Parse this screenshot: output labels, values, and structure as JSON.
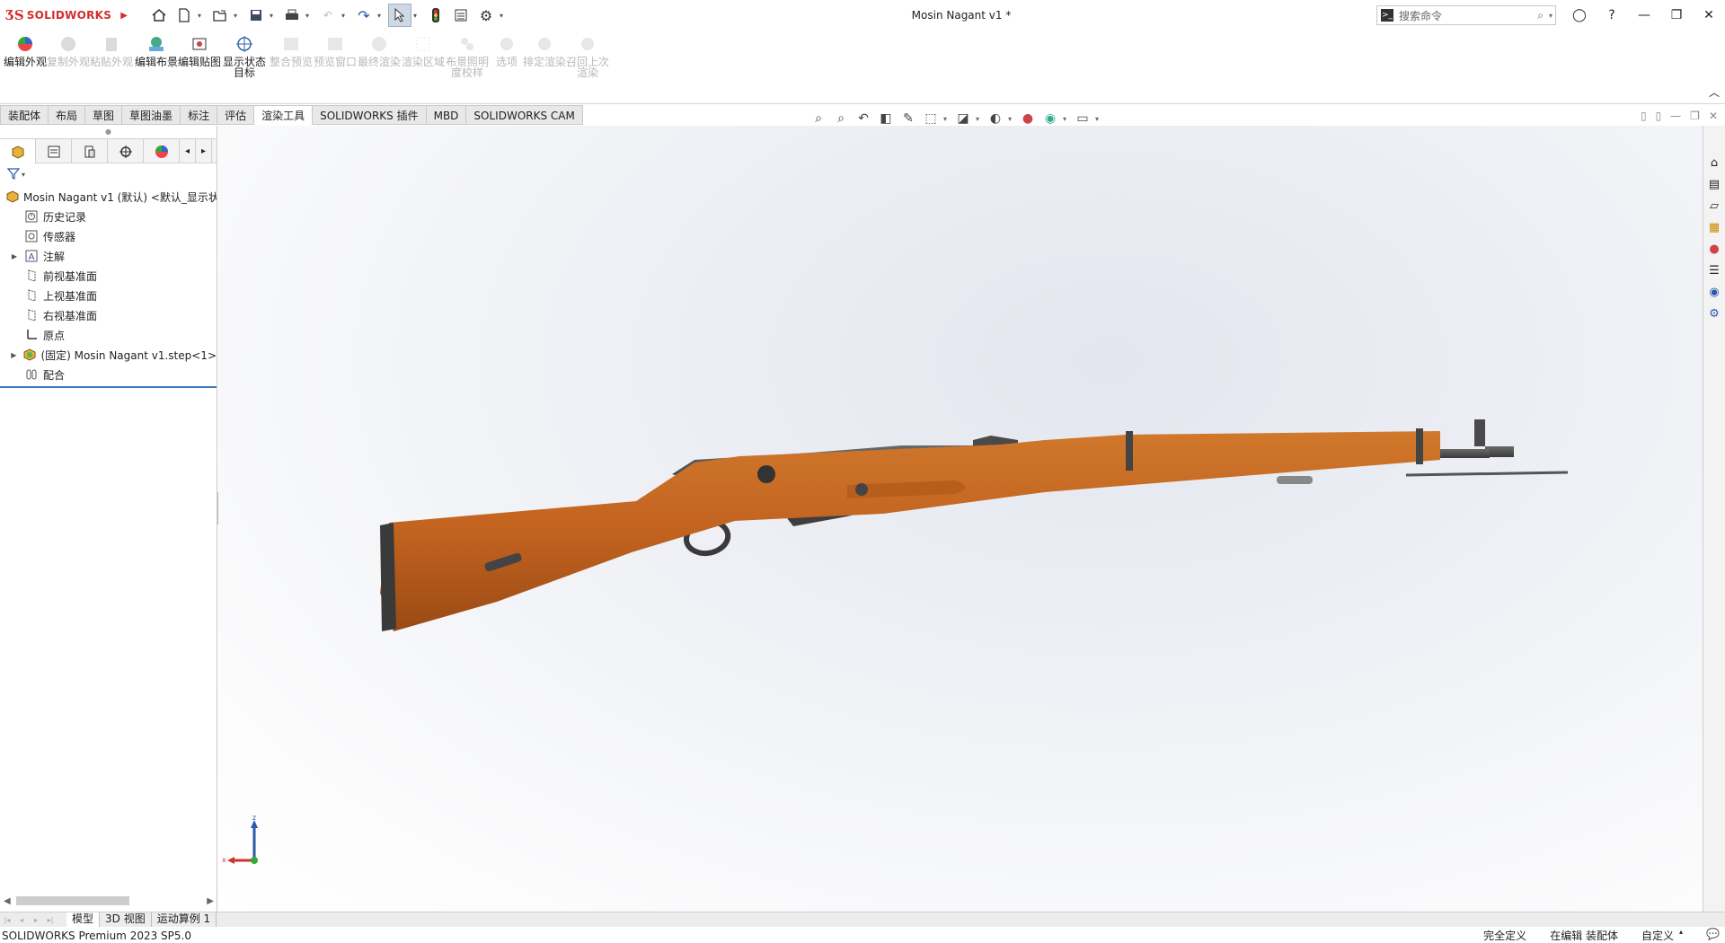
{
  "app": {
    "brand": "SOLIDWORKS",
    "document_title": "Mosin Nagant v1 *"
  },
  "search": {
    "placeholder": "搜索命令"
  },
  "ribbon": {
    "buttons": [
      {
        "label": "编辑外观",
        "enabled": true
      },
      {
        "label": "复制外观",
        "enabled": false
      },
      {
        "label": "粘贴外观",
        "enabled": false
      },
      {
        "label": "编辑布景",
        "enabled": true
      },
      {
        "label": "编辑贴图",
        "enabled": true
      },
      {
        "label": "显示状态目标",
        "enabled": true
      },
      {
        "label": "整合预览",
        "enabled": false
      },
      {
        "label": "预览窗口",
        "enabled": false
      },
      {
        "label": "最终渲染",
        "enabled": false
      },
      {
        "label": "渲染区域",
        "enabled": false
      },
      {
        "label": "布景照明度校样",
        "enabled": false
      },
      {
        "label": "选项",
        "enabled": false
      },
      {
        "label": "排定渲染",
        "enabled": false
      },
      {
        "label": "召回上次渲染",
        "enabled": false
      }
    ]
  },
  "tabs": [
    "装配体",
    "布局",
    "草图",
    "草图油墨",
    "标注",
    "评估",
    "渲染工具",
    "SOLIDWORKS 插件",
    "MBD",
    "SOLIDWORKS CAM"
  ],
  "active_tab": "渲染工具",
  "tree": {
    "root": "Mosin Nagant v1 (默认) <默认_显示状",
    "items": [
      {
        "label": "历史记录",
        "icon": "history-icon"
      },
      {
        "label": "传感器",
        "icon": "sensor-icon"
      },
      {
        "label": "注解",
        "icon": "annotation-icon",
        "expandable": true
      },
      {
        "label": "前视基准面",
        "icon": "plane-icon"
      },
      {
        "label": "上视基准面",
        "icon": "plane-icon"
      },
      {
        "label": "右视基准面",
        "icon": "plane-icon"
      },
      {
        "label": "原点",
        "icon": "origin-icon"
      },
      {
        "label": "(固定) Mosin Nagant v1.step<1>",
        "icon": "part-icon",
        "expandable": true
      },
      {
        "label": "配合",
        "icon": "mates-icon"
      }
    ]
  },
  "triad": {
    "z": "z",
    "x": "x"
  },
  "bottom_tabs": [
    "模型",
    "3D 视图",
    "运动算例 1"
  ],
  "status": {
    "product": "SOLIDWORKS Premium 2023 SP5.0",
    "definition": "完全定义",
    "mode": "在编辑 装配体",
    "units": "自定义"
  }
}
